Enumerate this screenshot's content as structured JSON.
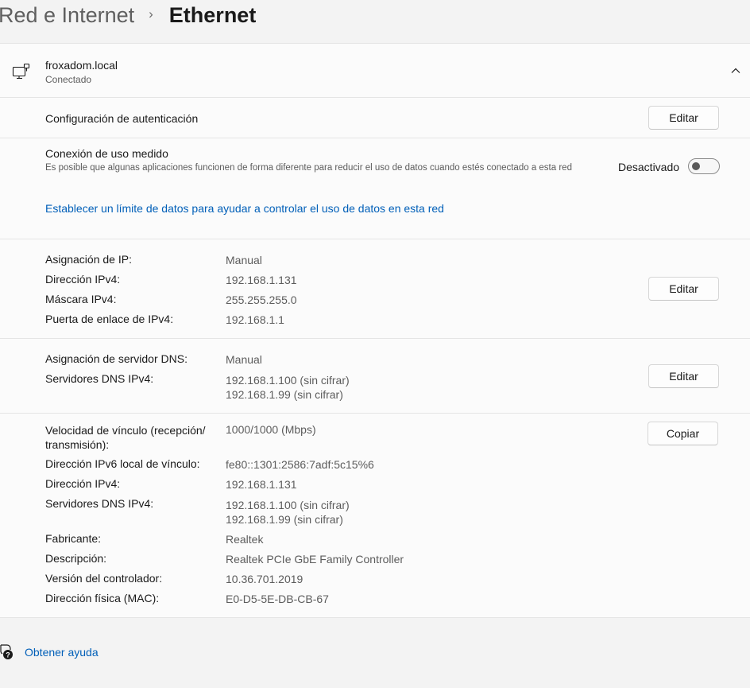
{
  "breadcrumb": {
    "parent": "Red e Internet",
    "separator": "›",
    "current": "Ethernet"
  },
  "network": {
    "name": "froxadom.local",
    "status": "Conectado",
    "icon": "ethernet-computer-icon",
    "collapse_icon": "chevron-up-icon"
  },
  "auth": {
    "label": "Configuración de autenticación",
    "button": "Editar"
  },
  "metered": {
    "label": "Conexión de uso medido",
    "description": "Es posible que algunas aplicaciones funcionen de forma diferente para reducir el uso de datos cuando estés conectado a esta red",
    "toggle_label": "Desactivado",
    "toggle_on": false,
    "data_limit_link": "Establecer un límite de datos para ayudar a controlar el uso de datos en esta red"
  },
  "ip_section": {
    "rows": [
      {
        "label": "Asignación de IP:",
        "value": "Manual"
      },
      {
        "label": "Dirección IPv4:",
        "value": "192.168.1.131"
      },
      {
        "label": "Máscara IPv4:",
        "value": "255.255.255.0"
      },
      {
        "label": "Puerta de enlace de IPv4:",
        "value": "192.168.1.1"
      }
    ],
    "button": "Editar"
  },
  "dns_section": {
    "assignment_label": "Asignación de servidor DNS:",
    "assignment_value": "Manual",
    "servers_label": "Servidores DNS IPv4:",
    "servers": [
      "192.168.1.100 (sin cifrar)",
      "192.168.1.99 (sin cifrar)"
    ],
    "button": "Editar"
  },
  "properties": {
    "link_speed_label_line1": "Velocidad de vínculo (recepción/",
    "link_speed_label_line2": "transmisión):",
    "link_speed_value": "1000/1000 (Mbps)",
    "ipv6_label": "Dirección IPv6 local de vínculo:",
    "ipv6_value": "fe80::1301:2586:7adf:5c15%6",
    "ipv4_label": "Dirección IPv4:",
    "ipv4_value": "192.168.1.131",
    "dns_label": "Servidores DNS IPv4:",
    "dns_values": [
      "192.168.1.100 (sin cifrar)",
      "192.168.1.99 (sin cifrar)"
    ],
    "manufacturer_label": "Fabricante:",
    "manufacturer_value": "Realtek",
    "description_label": "Descripción:",
    "description_value": "Realtek PCIe GbE Family Controller",
    "driver_label": "Versión del controlador:",
    "driver_value": "10.36.701.2019",
    "mac_label": "Dirección física (MAC):",
    "mac_value": "E0-D5-5E-DB-CB-67",
    "copy_button": "Copiar"
  },
  "help": {
    "icon": "help-chat-icon",
    "label": "Obtener ayuda"
  },
  "colors": {
    "accent": "#005fb8",
    "page_bg": "#f3f3f3",
    "card_bg": "#fbfbfb"
  }
}
